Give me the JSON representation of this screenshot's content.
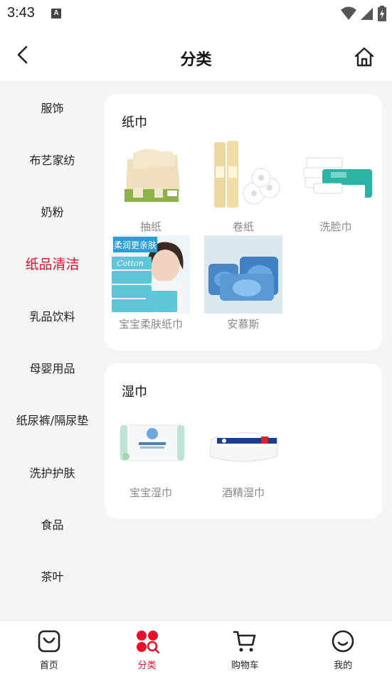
{
  "status_bar": {
    "time": "3:43",
    "notification_glyph": "A"
  },
  "header": {
    "title": "分类"
  },
  "sidebar": {
    "items": [
      {
        "label": "服饰"
      },
      {
        "label": "布艺家纺"
      },
      {
        "label": "奶粉"
      },
      {
        "label": "纸品清洁",
        "active": true
      },
      {
        "label": "乳品饮料"
      },
      {
        "label": "母婴用品"
      },
      {
        "label": "纸尿裤/隔尿垫"
      },
      {
        "label": "洗护护肤"
      },
      {
        "label": "食品"
      },
      {
        "label": "茶叶"
      }
    ]
  },
  "sections": [
    {
      "title": "纸巾",
      "products": [
        {
          "label": "抽纸",
          "icon": "tissue-box-image"
        },
        {
          "label": "卷纸",
          "icon": "toilet-roll-image"
        },
        {
          "label": "洗脸巾",
          "icon": "face-towel-image"
        },
        {
          "label": "宝宝柔肤纸巾",
          "icon": "baby-tissue-image",
          "image_text": "柔润更亲肤",
          "brand_text": "Cotton"
        },
        {
          "label": "安慕斯",
          "icon": "anmus-pack-image"
        }
      ]
    },
    {
      "title": "湿巾",
      "products": [
        {
          "label": "宝宝湿巾",
          "icon": "baby-wipes-image"
        },
        {
          "label": "酒精湿巾",
          "icon": "alcohol-wipes-image"
        }
      ]
    }
  ],
  "tabbar": {
    "tabs": [
      {
        "label": "首页",
        "icon": "home-bag-icon"
      },
      {
        "label": "分类",
        "icon": "category-icon",
        "active": true
      },
      {
        "label": "购物车",
        "icon": "cart-icon"
      },
      {
        "label": "我的",
        "icon": "profile-smile-icon"
      }
    ]
  },
  "colors": {
    "accent": "#e8102b",
    "text": "#222222",
    "muted": "#888888",
    "background": "#f5f5f5"
  }
}
